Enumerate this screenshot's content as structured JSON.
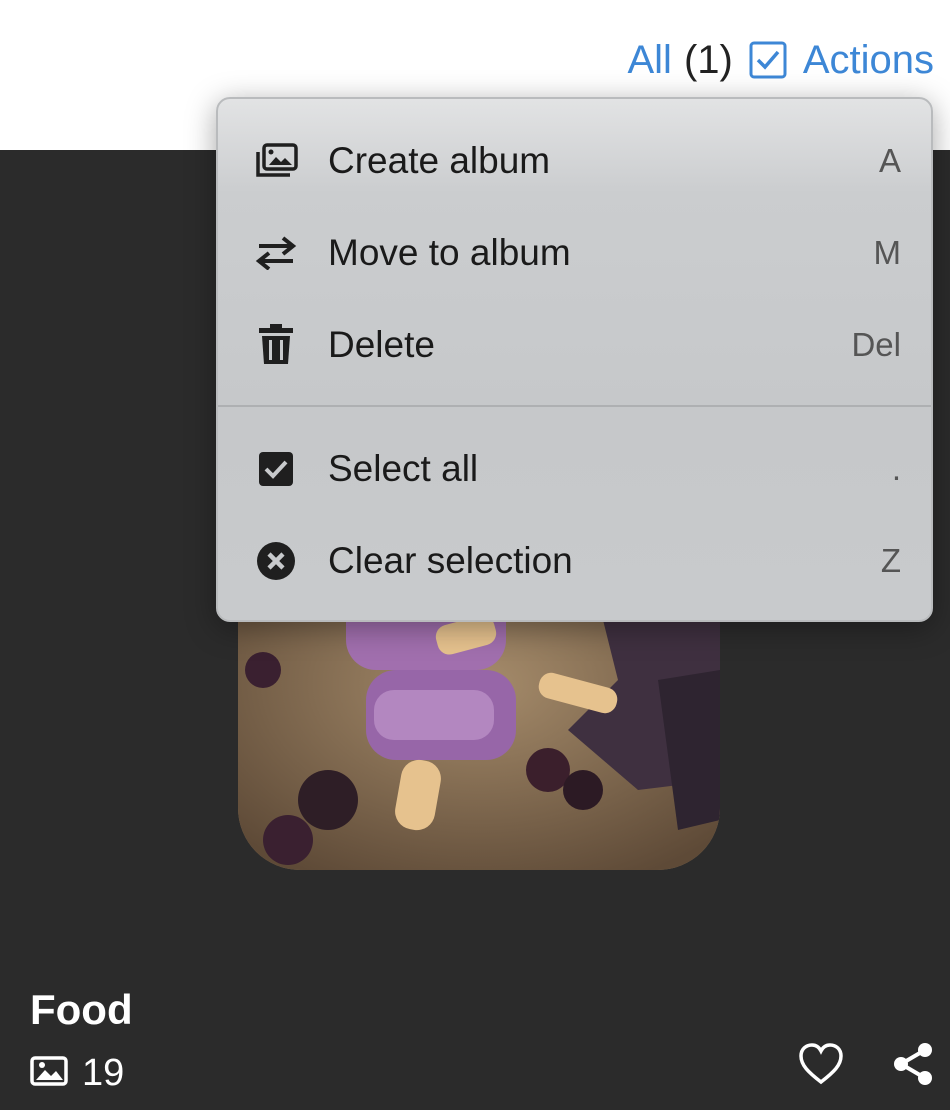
{
  "header": {
    "all_label": "All",
    "selected_count": "(1)",
    "actions_label": "Actions"
  },
  "menu": {
    "items": [
      {
        "label": "Create album",
        "shortcut": "A",
        "icon": "create-album-icon"
      },
      {
        "label": "Move to album",
        "shortcut": "M",
        "icon": "move-arrows-icon"
      },
      {
        "label": "Delete",
        "shortcut": "Del",
        "icon": "trash-icon"
      },
      {
        "label": "Select all",
        "shortcut": ".",
        "icon": "checkbox-checked-icon"
      },
      {
        "label": "Clear selection",
        "shortcut": "Z",
        "icon": "close-circle-icon"
      }
    ]
  },
  "album": {
    "title": "Food",
    "count": "19"
  },
  "colors": {
    "accent": "#3d87d6",
    "background": "#2b2b2b",
    "menu_bg": "#c8cacc"
  }
}
